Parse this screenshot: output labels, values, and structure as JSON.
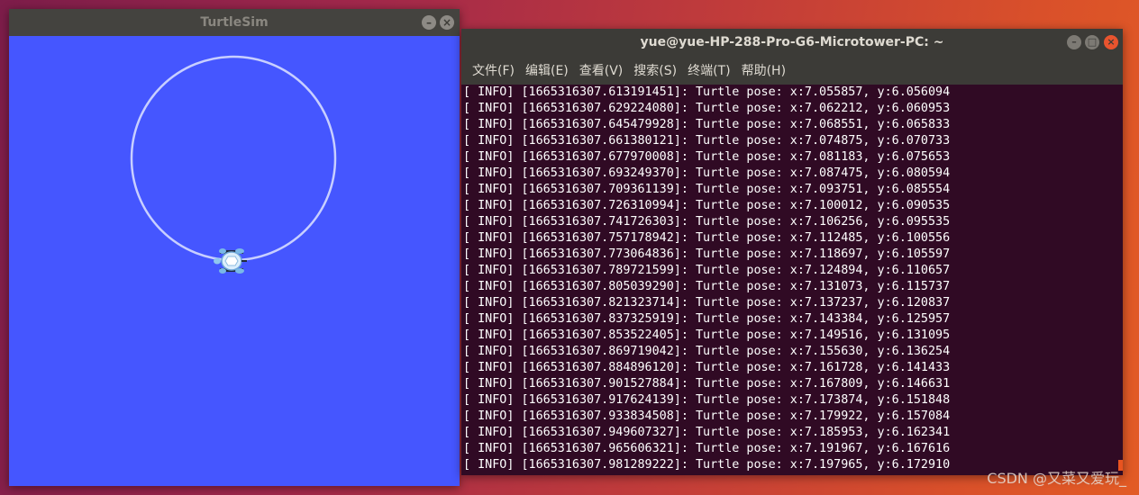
{
  "turtlesim": {
    "title": "TurtleSim",
    "minimize_glyph": "–",
    "close_glyph": "×",
    "background_color": "#4556ff",
    "trail_color": "#c8cfff"
  },
  "terminal": {
    "title": "yue@yue-HP-288-Pro-G6-Microtower-PC: ~",
    "minimize_glyph": "–",
    "maximize_glyph": "□",
    "close_glyph": "×",
    "menu": [
      {
        "label": "文件(F)"
      },
      {
        "label": "编辑(E)"
      },
      {
        "label": "查看(V)"
      },
      {
        "label": "搜索(S)"
      },
      {
        "label": "终端(T)"
      },
      {
        "label": "帮助(H)"
      }
    ],
    "lines": [
      "[ INFO] [1665316307.613191451]: Turtle pose: x:7.055857, y:6.056094",
      "[ INFO] [1665316307.629224080]: Turtle pose: x:7.062212, y:6.060953",
      "[ INFO] [1665316307.645479928]: Turtle pose: x:7.068551, y:6.065833",
      "[ INFO] [1665316307.661380121]: Turtle pose: x:7.074875, y:6.070733",
      "[ INFO] [1665316307.677970008]: Turtle pose: x:7.081183, y:6.075653",
      "[ INFO] [1665316307.693249370]: Turtle pose: x:7.087475, y:6.080594",
      "[ INFO] [1665316307.709361139]: Turtle pose: x:7.093751, y:6.085554",
      "[ INFO] [1665316307.726310994]: Turtle pose: x:7.100012, y:6.090535",
      "[ INFO] [1665316307.741726303]: Turtle pose: x:7.106256, y:6.095535",
      "[ INFO] [1665316307.757178942]: Turtle pose: x:7.112485, y:6.100556",
      "[ INFO] [1665316307.773064836]: Turtle pose: x:7.118697, y:6.105597",
      "[ INFO] [1665316307.789721599]: Turtle pose: x:7.124894, y:6.110657",
      "[ INFO] [1665316307.805039290]: Turtle pose: x:7.131073, y:6.115737",
      "[ INFO] [1665316307.821323714]: Turtle pose: x:7.137237, y:6.120837",
      "[ INFO] [1665316307.837325919]: Turtle pose: x:7.143384, y:6.125957",
      "[ INFO] [1665316307.853522405]: Turtle pose: x:7.149516, y:6.131095",
      "[ INFO] [1665316307.869719042]: Turtle pose: x:7.155630, y:6.136254",
      "[ INFO] [1665316307.884896120]: Turtle pose: x:7.161728, y:6.141433",
      "[ INFO] [1665316307.901527884]: Turtle pose: x:7.167809, y:6.146631",
      "[ INFO] [1665316307.917624139]: Turtle pose: x:7.173874, y:6.151848",
      "[ INFO] [1665316307.933834508]: Turtle pose: x:7.179922, y:6.157084",
      "[ INFO] [1665316307.949607327]: Turtle pose: x:7.185953, y:6.162341",
      "[ INFO] [1665316307.965606321]: Turtle pose: x:7.191967, y:6.167616",
      "[ INFO] [1665316307.981289222]: Turtle pose: x:7.197965, y:6.172910"
    ]
  },
  "watermark": "CSDN @又菜又爱玩_"
}
